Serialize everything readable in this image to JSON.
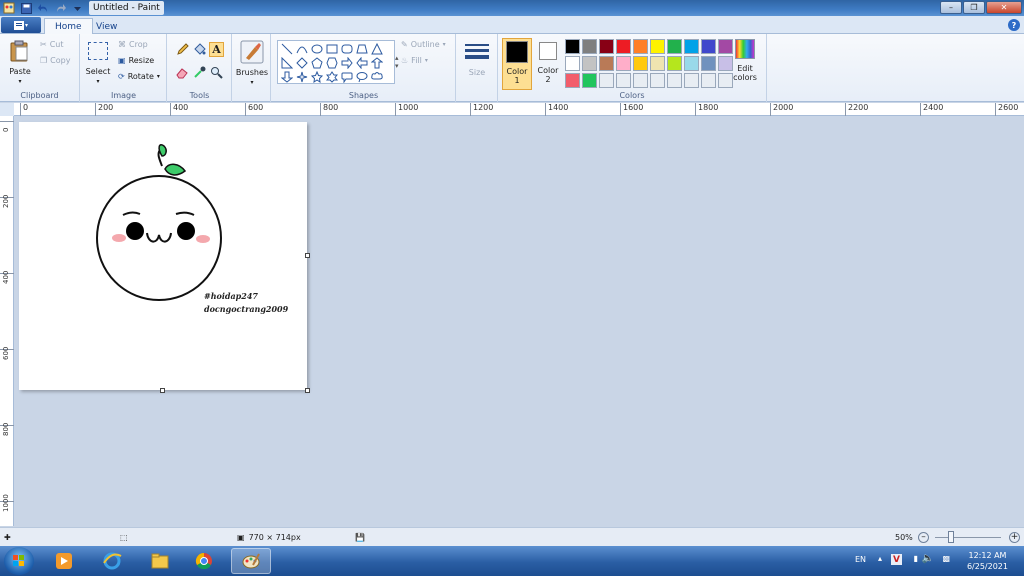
{
  "window": {
    "title": "Untitled - Paint"
  },
  "tabs": [
    {
      "label": "Home"
    },
    {
      "label": "View"
    }
  ],
  "clipboard": {
    "paste": "Paste",
    "cut": "Cut",
    "copy": "Copy",
    "group": "Clipboard"
  },
  "image": {
    "select": "Select",
    "crop": "Crop",
    "resize": "Resize",
    "rotate": "Rotate",
    "group": "Image"
  },
  "tools": {
    "group": "Tools",
    "brushes": "Brushes"
  },
  "shapes": {
    "outline": "Outline",
    "fill": "Fill",
    "group": "Shapes"
  },
  "size": {
    "label": "Size"
  },
  "colors": {
    "group": "Colors",
    "color1_label": "Color",
    "color1_num": "1",
    "color1_value": "#000000",
    "color2_label": "Color",
    "color2_num": "2",
    "color2_value": "#ffffff",
    "edit_line1": "Edit",
    "edit_line2": "colors",
    "palette": [
      "#000000",
      "#7f7f7f",
      "#880015",
      "#ed1c24",
      "#ff7f27",
      "#fff200",
      "#22b14c",
      "#00a2e8",
      "#3f48cc",
      "#a349a4",
      "#ffffff",
      "#c3c3c3",
      "#b97a57",
      "#ffaec9",
      "#ffc90e",
      "#efe4b0",
      "#b5e61d",
      "#99d9ea",
      "#7092be",
      "#c8bfe7",
      "#f25d6b",
      "#22c55e",
      "#e8edf3",
      "#e8edf3",
      "#e8edf3",
      "#e8edf3",
      "#e8edf3",
      "#e8edf3",
      "#e8edf3",
      "#e8edf3"
    ]
  },
  "ruler": {
    "h": [
      "0",
      "200",
      "400",
      "600",
      "800",
      "1000",
      "1200",
      "1400",
      "1600",
      "1800",
      "2000",
      "2200",
      "2400",
      "2600"
    ],
    "v": [
      "0",
      "200",
      "400",
      "600",
      "800",
      "1000"
    ]
  },
  "canvas": {
    "tag1": "#hoidap247",
    "tag2": "docngoctrang2009"
  },
  "status": {
    "dimensions": "770 × 714px",
    "zoom": "50%"
  },
  "taskbar": {
    "lang": "EN",
    "time": "12:12 AM",
    "date": "6/25/2021"
  }
}
